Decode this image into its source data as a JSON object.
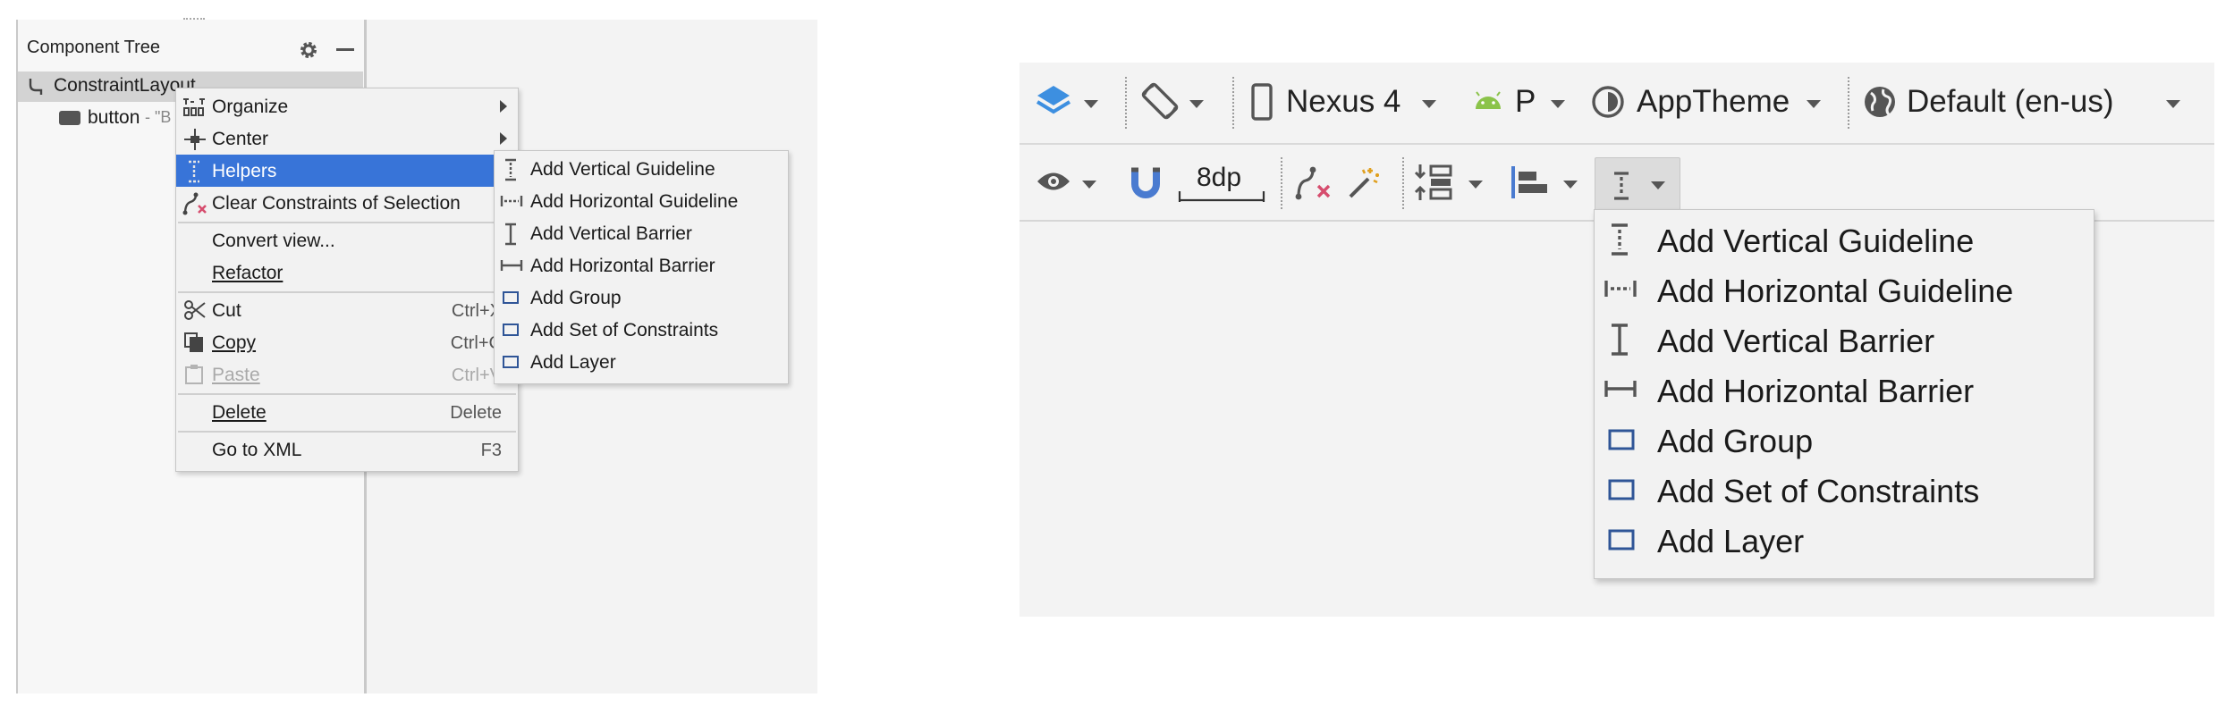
{
  "component_tree": {
    "title": "Component Tree",
    "root": "ConstraintLayout",
    "child": "button",
    "child_suffix": "- \"B"
  },
  "context_menu": {
    "items": [
      {
        "label": "Organize",
        "submenu": true,
        "icon": "organize-icon"
      },
      {
        "label": "Center",
        "submenu": true,
        "icon": "center-icon"
      },
      {
        "label": "Helpers",
        "submenu": true,
        "icon": "guideline-vertical-icon",
        "selected": true
      },
      {
        "label": "Clear Constraints of Selection",
        "icon": "clear-constraints-icon"
      },
      {
        "label": "Convert view..."
      },
      {
        "label": "Refactor",
        "submenu": true
      },
      {
        "label": "Cut",
        "shortcut": "Ctrl+X",
        "icon": "scissors-icon"
      },
      {
        "label": "Copy",
        "shortcut": "Ctrl+C",
        "icon": "copy-icon"
      },
      {
        "label": "Paste",
        "shortcut": "Ctrl+V",
        "icon": "paste-icon",
        "disabled": true
      },
      {
        "label": "Delete",
        "shortcut": "Delete"
      },
      {
        "label": "Go to XML",
        "shortcut": "F3"
      }
    ]
  },
  "helpers_submenu": {
    "items": [
      {
        "label": "Add Vertical Guideline",
        "icon": "vertical-guideline-icon"
      },
      {
        "label": "Add Horizontal Guideline",
        "icon": "horizontal-guideline-icon"
      },
      {
        "label": "Add Vertical Barrier",
        "icon": "vertical-barrier-icon"
      },
      {
        "label": "Add Horizontal Barrier",
        "icon": "horizontal-barrier-icon"
      },
      {
        "label": "Add Group",
        "icon": "group-icon"
      },
      {
        "label": "Add Set of Constraints",
        "icon": "constraint-set-icon"
      },
      {
        "label": "Add Layer",
        "icon": "layer-icon"
      }
    ]
  },
  "toolbar": {
    "device": "Nexus 4",
    "api": "P",
    "theme": "AppTheme",
    "locale": "Default (en-us)",
    "margin": "8dp"
  },
  "helpers_dropdown": {
    "items": [
      {
        "label": "Add Vertical Guideline",
        "icon": "vertical-guideline-icon"
      },
      {
        "label": "Add Horizontal Guideline",
        "icon": "horizontal-guideline-icon"
      },
      {
        "label": "Add Vertical Barrier",
        "icon": "vertical-barrier-icon"
      },
      {
        "label": "Add Horizontal Barrier",
        "icon": "horizontal-barrier-icon"
      },
      {
        "label": "Add Group",
        "icon": "group-icon"
      },
      {
        "label": "Add Set of Constraints",
        "icon": "constraint-set-icon"
      },
      {
        "label": "Add Layer",
        "icon": "layer-icon"
      }
    ]
  },
  "colors": {
    "selection": "#3874d8",
    "layers_icon": "#3d8fe0",
    "android_green": "#8bc34a",
    "magnet_blue": "#4a7bd0",
    "clear_x_red": "#d64d6e",
    "box_icon_blue": "#2f5597"
  }
}
